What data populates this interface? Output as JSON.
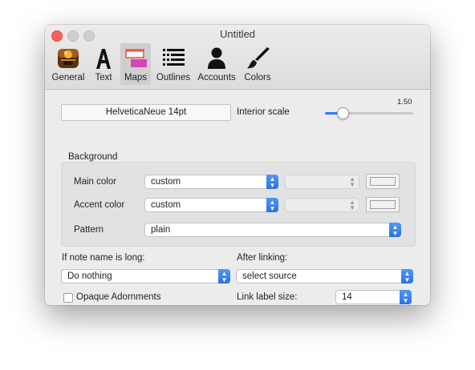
{
  "window": {
    "title": "Untitled"
  },
  "toolbar": {
    "tabs": [
      {
        "label": "General",
        "icon": "app-icon"
      },
      {
        "label": "Text",
        "icon": "letter-a-icon"
      },
      {
        "label": "Maps",
        "icon": "map-note-icon",
        "selected": true
      },
      {
        "label": "Outlines",
        "icon": "outline-list-icon"
      },
      {
        "label": "Accounts",
        "icon": "person-icon"
      },
      {
        "label": "Colors",
        "icon": "paintbrush-icon"
      }
    ]
  },
  "maps": {
    "font_button": "HelveticaNeue 14pt",
    "interior_scale": {
      "label": "Interior scale",
      "value": "1.50",
      "level": 0.15
    },
    "background": {
      "label": "Background",
      "main_color": {
        "label": "Main color",
        "value": "custom"
      },
      "accent_color": {
        "label": "Accent color",
        "value": "custom"
      },
      "pattern": {
        "label": "Pattern",
        "value": "plain"
      }
    },
    "long_name": {
      "label": "If note name is long:",
      "value": "Do nothing"
    },
    "after_linking": {
      "label": "After linking:",
      "value": "select source"
    },
    "opaque_adornments": {
      "label": "Opaque Adornments",
      "checked": false
    },
    "link_label_size": {
      "label": "Link label size:",
      "value": "14"
    }
  },
  "colors": {
    "accent": "#2f7bf5",
    "close": "#fc605b"
  }
}
